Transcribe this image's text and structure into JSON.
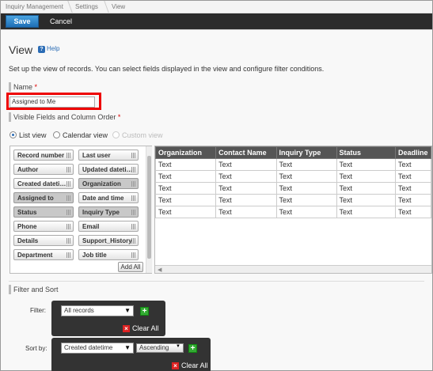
{
  "breadcrumb": [
    "Inquiry Management",
    "Settings",
    "View"
  ],
  "toolbar": {
    "save_label": "Save",
    "cancel_label": "Cancel"
  },
  "page": {
    "title": "View",
    "help_label": "Help",
    "description": "Set up the view of records. You can select fields displayed in the view and configure filter conditions."
  },
  "name_section": {
    "label": "Name",
    "required_mark": "*",
    "value": "Assigned to Me"
  },
  "fields_section": {
    "label": "Visible Fields and Column Order",
    "required_mark": "*"
  },
  "view_types": [
    {
      "label": "List view",
      "selected": true,
      "enabled": true
    },
    {
      "label": "Calendar view",
      "selected": false,
      "enabled": true
    },
    {
      "label": "Custom view",
      "selected": false,
      "enabled": false
    }
  ],
  "palette_fields": [
    {
      "label": "Record number",
      "used": false
    },
    {
      "label": "Last user",
      "used": false
    },
    {
      "label": "Author",
      "used": false
    },
    {
      "label": "Updated dateti…",
      "used": false
    },
    {
      "label": "Created dateti…",
      "used": false
    },
    {
      "label": "Organization",
      "used": true
    },
    {
      "label": "Assigned to",
      "used": true
    },
    {
      "label": "Date and time",
      "used": false
    },
    {
      "label": "Status",
      "used": true
    },
    {
      "label": "Inquiry Type",
      "used": true
    },
    {
      "label": "Phone",
      "used": false
    },
    {
      "label": "Email",
      "used": false
    },
    {
      "label": "Details",
      "used": false
    },
    {
      "label": "Support_History",
      "used": false
    },
    {
      "label": "Department",
      "used": false
    },
    {
      "label": "Job title",
      "used": false
    }
  ],
  "add_all_label": "Add All",
  "grid": {
    "columns": [
      "Organization",
      "Contact Name",
      "Inquiry Type",
      "Status",
      "Deadline"
    ],
    "rows": [
      [
        "Text",
        "Text",
        "Text",
        "Text",
        "Text"
      ],
      [
        "Text",
        "Text",
        "Text",
        "Text",
        "Text"
      ],
      [
        "Text",
        "Text",
        "Text",
        "Text",
        "Text"
      ],
      [
        "Text",
        "Text",
        "Text",
        "Text",
        "Text"
      ],
      [
        "Text",
        "Text",
        "Text",
        "Text",
        "Text"
      ]
    ]
  },
  "filter_sort": {
    "section_label": "Filter and Sort",
    "filter_label": "Filter:",
    "filter_value": "All records",
    "filter_clear": "Clear All",
    "sort_label": "Sort by:",
    "sort_field": "Created datetime",
    "sort_order": "Ascending",
    "sort_clear": "Clear All"
  },
  "icons": {
    "help": "question-icon",
    "grip": "drag-handle-icon",
    "add": "plus-icon",
    "clear": "close-icon",
    "dropdown": "chevron-down-icon"
  },
  "colors": {
    "toolbar": "#2b2b2b",
    "save_button": "#1e6fb5",
    "header": "#555555",
    "highlight": "#e00000",
    "add_button": "#33aa33",
    "clear_icon": "#dd2222"
  }
}
